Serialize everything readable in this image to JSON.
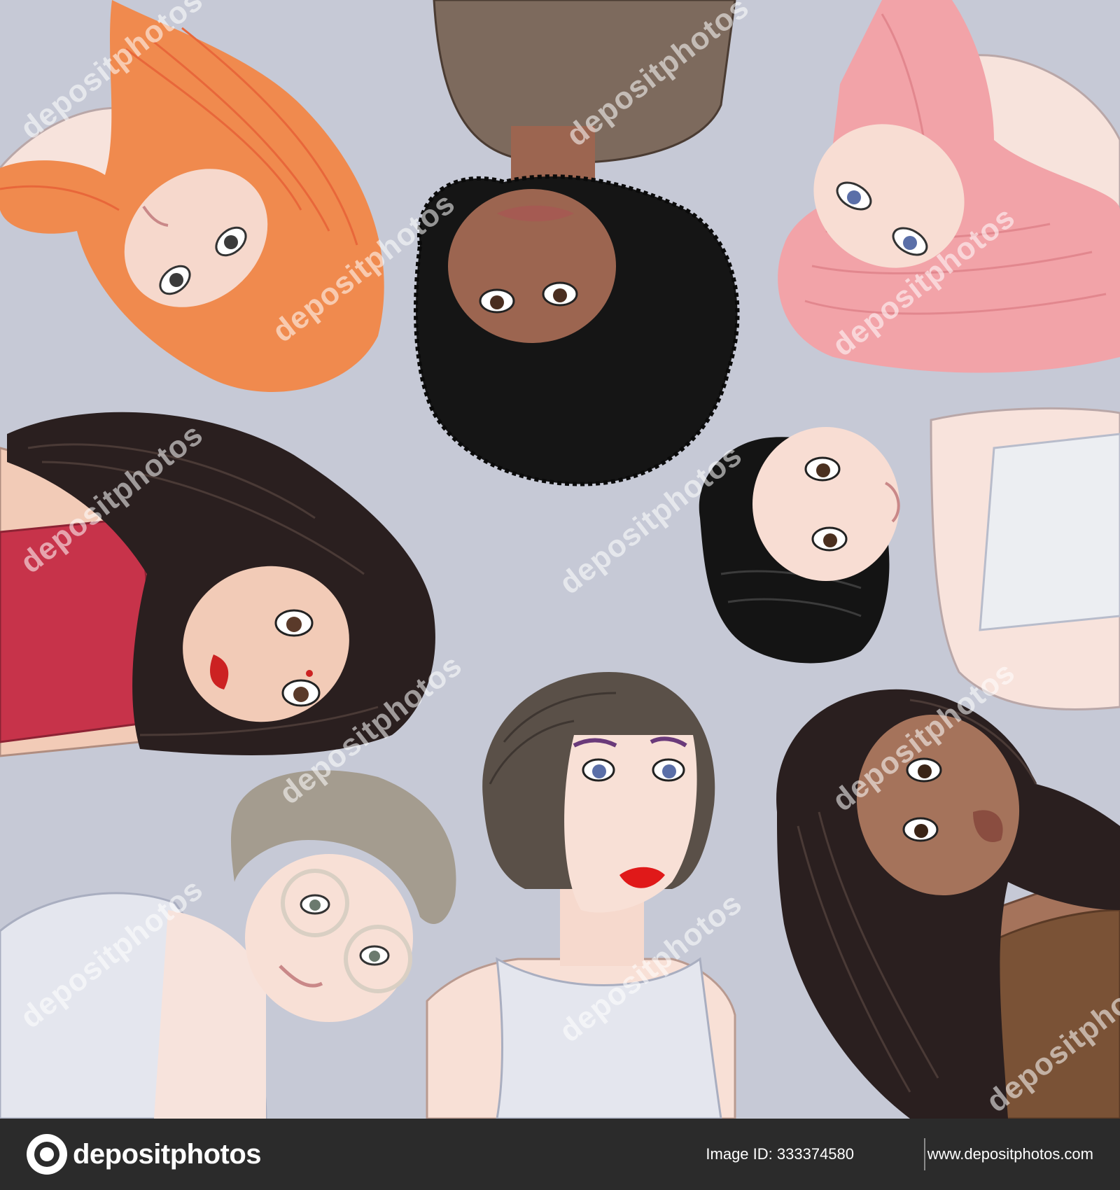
{
  "watermark_text": "depositphotos",
  "footer": {
    "logo_text": "depositphotos",
    "image_id": "Image ID: 333374580",
    "site_url": "www.depositphotos.com"
  },
  "colors": {
    "background": "#c6c9d6",
    "footer": "#2b2b2b",
    "ginger_hair": "#f08a4e",
    "pink_hair": "#f2a3a8",
    "dark_hair": "#2a1f1f",
    "black_hair": "#141414",
    "bob_hair": "#5a5048",
    "short_gray_hair": "#a49c8f"
  }
}
